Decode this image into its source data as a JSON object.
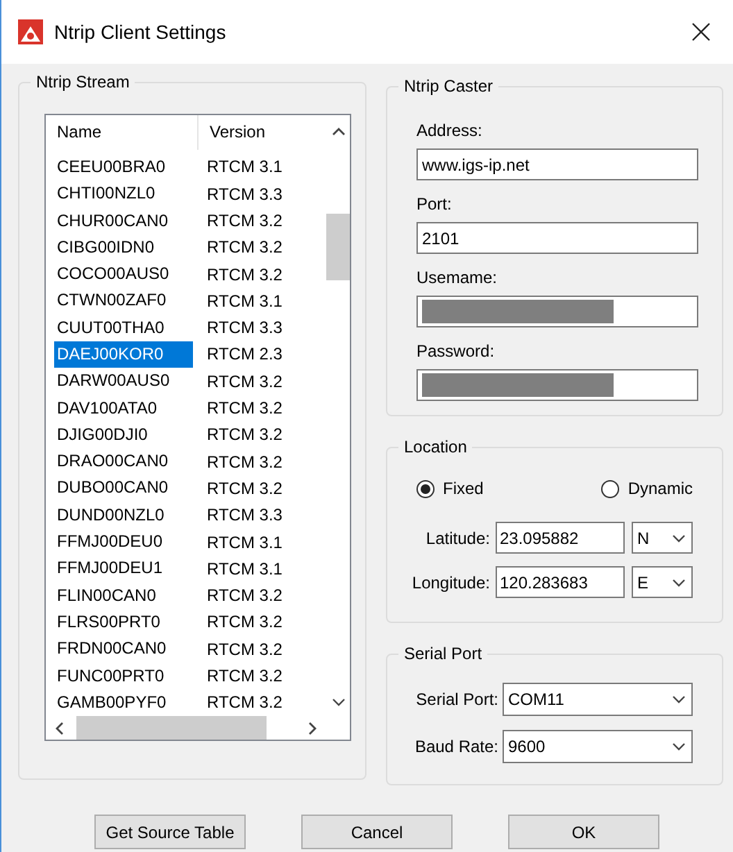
{
  "window": {
    "title": "Ntrip Client Settings"
  },
  "stream": {
    "title": "Ntrip Stream",
    "columns": [
      "Name",
      "Version"
    ],
    "rows": [
      {
        "name": "CEEU00BRA0",
        "version": "RTCM 3.1",
        "selected": false
      },
      {
        "name": "CHTI00NZL0",
        "version": "RTCM 3.3",
        "selected": false
      },
      {
        "name": "CHUR00CAN0",
        "version": "RTCM 3.2",
        "selected": false
      },
      {
        "name": "CIBG00IDN0",
        "version": "RTCM 3.2",
        "selected": false
      },
      {
        "name": "COCO00AUS0",
        "version": "RTCM 3.2",
        "selected": false
      },
      {
        "name": "CTWN00ZAF0",
        "version": "RTCM 3.1",
        "selected": false
      },
      {
        "name": "CUUT00THA0",
        "version": "RTCM 3.3",
        "selected": false
      },
      {
        "name": "DAEJ00KOR0",
        "version": "RTCM 2.3",
        "selected": true
      },
      {
        "name": "DARW00AUS0",
        "version": "RTCM 3.2",
        "selected": false
      },
      {
        "name": "DAV100ATA0",
        "version": "RTCM 3.2",
        "selected": false
      },
      {
        "name": "DJIG00DJI0",
        "version": "RTCM 3.2",
        "selected": false
      },
      {
        "name": "DRAO00CAN0",
        "version": "RTCM 3.2",
        "selected": false
      },
      {
        "name": "DUBO00CAN0",
        "version": "RTCM 3.2",
        "selected": false
      },
      {
        "name": "DUND00NZL0",
        "version": "RTCM 3.3",
        "selected": false
      },
      {
        "name": "FFMJ00DEU0",
        "version": "RTCM 3.1",
        "selected": false
      },
      {
        "name": "FFMJ00DEU1",
        "version": "RTCM 3.1",
        "selected": false
      },
      {
        "name": "FLIN00CAN0",
        "version": "RTCM 3.2",
        "selected": false
      },
      {
        "name": "FLRS00PRT0",
        "version": "RTCM 3.2",
        "selected": false
      },
      {
        "name": "FRDN00CAN0",
        "version": "RTCM 3.2",
        "selected": false
      },
      {
        "name": "FUNC00PRT0",
        "version": "RTCM 3.2",
        "selected": false
      },
      {
        "name": "GAMB00PYF0",
        "version": "RTCM 3.2",
        "selected": false
      }
    ]
  },
  "caster": {
    "title": "Ntrip Caster",
    "fields": [
      {
        "label": "Address:",
        "value": "www.igs-ip.net",
        "redacted": false
      },
      {
        "label": "Port:",
        "value": "2101",
        "redacted": false
      },
      {
        "label": "Usemame:",
        "redacted": true
      },
      {
        "label": "Password:",
        "redacted": true
      }
    ]
  },
  "location": {
    "title": "Location",
    "modes": [
      {
        "label": "Fixed",
        "selected": true
      },
      {
        "label": "Dynamic",
        "selected": false
      }
    ],
    "coords": [
      {
        "label": "Latitude:",
        "value": "23.095882",
        "hemisphere": "N"
      },
      {
        "label": "Longitude:",
        "value": "120.283683",
        "hemisphere": "E"
      }
    ]
  },
  "serial": {
    "title": "Serial Port",
    "fields": [
      {
        "label": "Serial Port:",
        "value": "COM11"
      },
      {
        "label": "Baud Rate:",
        "value": "9600"
      }
    ]
  },
  "buttons": [
    "Get Source Table",
    "Cancel",
    "OK"
  ]
}
